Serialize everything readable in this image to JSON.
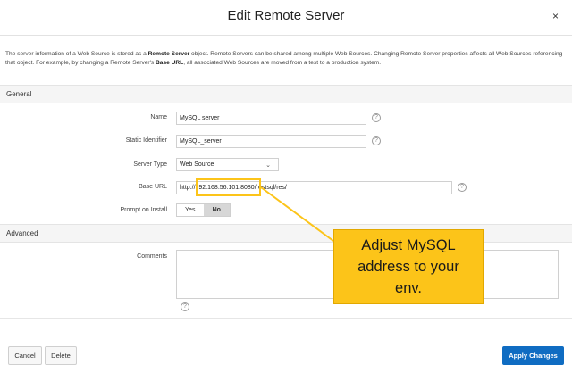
{
  "dialog": {
    "title": "Edit Remote Server",
    "close_glyph": "×"
  },
  "description": {
    "part1": "The server information of a Web Source is stored as a ",
    "bold1": "Remote Server",
    "part2": " object. Remote Servers can be shared among multiple Web Sources. Changing Remote Server properties affects all Web Sources referencing that object. For example, by changing a Remote Server's ",
    "bold2": "Base URL",
    "part3": ", all associated Web Sources are moved from a test to a production system."
  },
  "sections": {
    "general": "General",
    "advanced": "Advanced"
  },
  "form": {
    "name": {
      "label": "Name",
      "value": "MySQL server"
    },
    "static_identifier": {
      "label": "Static Identifier",
      "value": "MySQL_server"
    },
    "server_type": {
      "label": "Server Type",
      "value": "Web Source"
    },
    "base_url": {
      "label": "Base URL",
      "prefix": "http://",
      "host": "192.168.56.101:8080",
      "path": "/restsql/res/"
    },
    "prompt_on_install": {
      "label": "Prompt on Install",
      "options": [
        "Yes",
        "No"
      ],
      "selected": "No"
    },
    "comments": {
      "label": "Comments",
      "value": ""
    }
  },
  "help_glyph": "?",
  "footer": {
    "cancel": "Cancel",
    "delete": "Delete",
    "apply": "Apply Changes"
  },
  "annotation": {
    "lines": [
      "Adjust MySQL",
      "address to your",
      "env."
    ],
    "color": "#fcc419"
  },
  "colors": {
    "primary": "#0f6cc2",
    "highlight": "#fcc419"
  }
}
